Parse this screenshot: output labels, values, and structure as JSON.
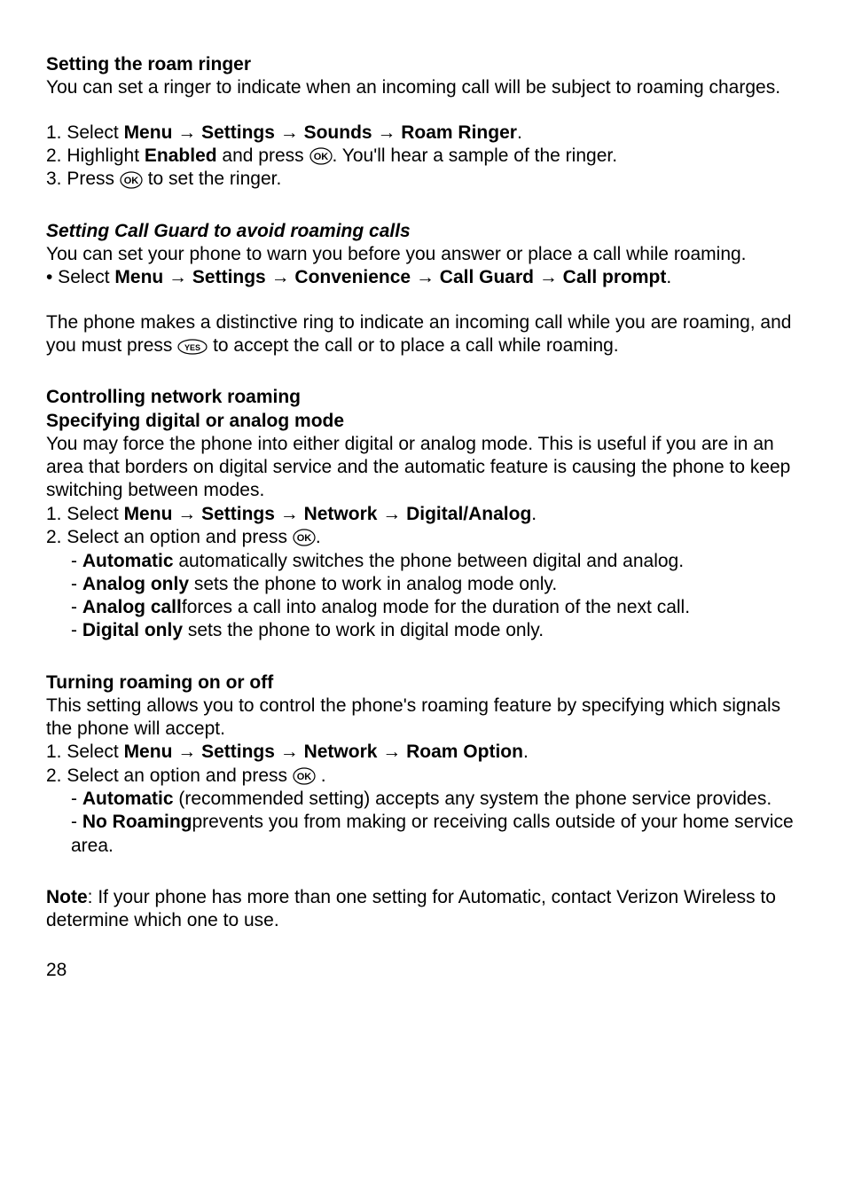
{
  "section1": {
    "heading": "Setting the roam ringer",
    "intro_pre": " You can set a ringer to indicate when an incoming call will be subject to roaming charges.",
    "step1_a": "1. Select ",
    "step1_menu": "Menu",
    "step1_arr1": " → ",
    "step1_settings": "Settings",
    "step1_arr2": " → ",
    "step1_sounds": "Sounds",
    "step1_arr3": " → ",
    "step1_roam": "Roam Ringer",
    "step1_end": ".",
    "step2_a": "2. Highlight ",
    "step2_enabled": "Enabled",
    "step2_b": " and press ",
    "step2_c": ". You'll hear a sample of the ringer.",
    "step3_a": "3. Press  ",
    "step3_b": " to set the ringer."
  },
  "section2": {
    "heading": "Setting Call Guard to avoid roaming calls",
    "intro": "You can set your phone to warn you before you answer or place a call while roaming.",
    "bullet_a": "• Select ",
    "menu": "Menu",
    "arr": " → ",
    "settings": "Settings",
    "convenience": "Convenience",
    "callguard": "Call Guard",
    "callprompt": "Call prompt",
    "end": ".",
    "para2_a": "The phone makes a distinctive ring to indicate an incoming call while you are roaming, and you must press ",
    "para2_b": " to accept the call or to place a call while roaming."
  },
  "section3": {
    "heading1": "Controlling network roaming",
    "heading2": "Specifying digital or analog mode",
    "intro": "You may force the phone into either digital or analog mode. This is useful if you are in an area that borders on digital service and the automatic feature is causing the phone to keep switching between modes.",
    "step1_a": "1. Select ",
    "menu": "Menu",
    "arr": " → ",
    "settings": "Settings",
    "network": "Network",
    "da": "Digital/Analog",
    "end": ".",
    "step2_a": "2. Select an option and press ",
    "step2_b": ".",
    "opt1_b": "Automatic",
    "opt1_t": " automatically switches the phone between digital and analog.",
    "opt2_b": "Analog only",
    "opt2_t": " sets the phone to work in analog mode only.",
    "opt3_b": "Analog call",
    "opt3_t": "forces a call into analog mode for the duration of the next call.",
    "opt4_b": "Digital only",
    "opt4_t": " sets the phone to work in digital mode only."
  },
  "section4": {
    "heading": "Turning roaming on or off",
    "intro": "This setting allows you to control the phone's roaming feature by specifying which signals the phone will accept.",
    "step1_a": "1. Select ",
    "menu": "Menu",
    "arr": " → ",
    "settings": "Settings",
    "network": "Network",
    "roamopt": "Roam Option",
    "end": ".",
    "step2_a": "2. Select an option and press ",
    "step2_b": " .",
    "opt1_b": "Automatic",
    "opt1_t": " (recommended setting) accepts any system the phone ser­vice provides.",
    "opt2_b": "No Roaming",
    "opt2_t": "prevents you from making or receiving calls outside of your home service area."
  },
  "note": {
    "label": "Note",
    "text": ": If your phone has more than one setting for Automatic, contact Verizon Wireless to determine which one to use."
  },
  "page": "28",
  "dash": "- ",
  "dashsp": "-  "
}
